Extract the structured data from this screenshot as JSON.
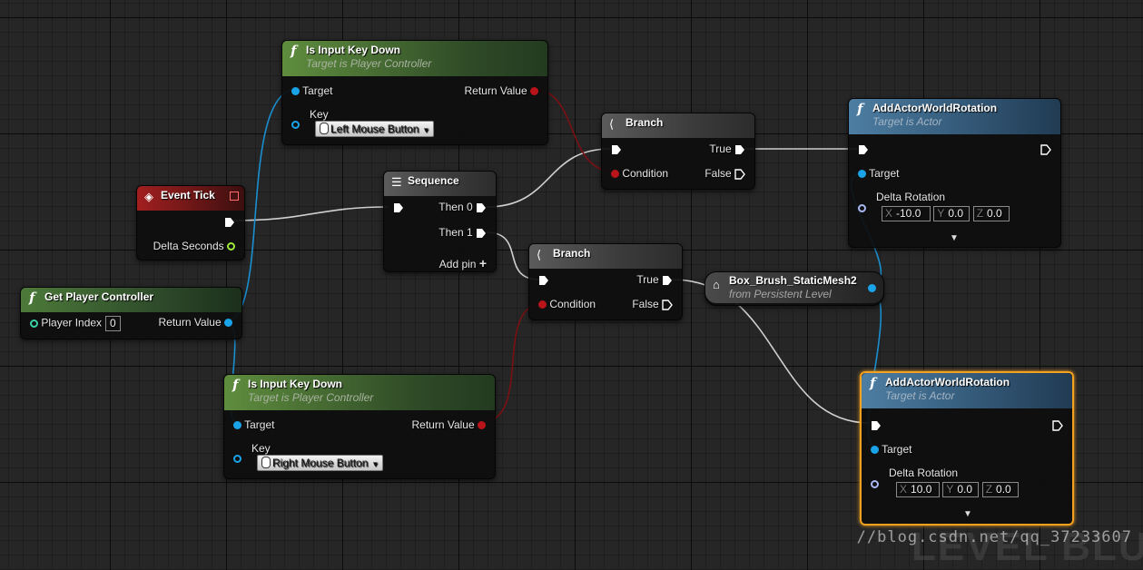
{
  "nodes": {
    "is_key_down_left": {
      "title": "Is Input Key Down",
      "subtitle": "Target is Player Controller",
      "target_label": "Target",
      "key_label": "Key",
      "key_value": "Left Mouse Button",
      "return_label": "Return Value"
    },
    "is_key_down_right": {
      "title": "Is Input Key Down",
      "subtitle": "Target is Player Controller",
      "target_label": "Target",
      "key_label": "Key",
      "key_value": "Right Mouse Button",
      "return_label": "Return Value"
    },
    "event_tick": {
      "title": "Event Tick",
      "delta_label": "Delta Seconds"
    },
    "get_player_controller": {
      "title": "Get Player Controller",
      "index_label": "Player Index",
      "index_value": "0",
      "return_label": "Return Value"
    },
    "sequence": {
      "title": "Sequence",
      "then0": "Then 0",
      "then1": "Then 1",
      "add_pin": "Add pin"
    },
    "branch_top": {
      "title": "Branch",
      "condition": "Condition",
      "true_label": "True",
      "false_label": "False"
    },
    "branch_bottom": {
      "title": "Branch",
      "condition": "Condition",
      "true_label": "True",
      "false_label": "False"
    },
    "box_brush": {
      "title": "Box_Brush_StaticMesh2",
      "subtitle": "from Persistent Level"
    },
    "add_rot_top": {
      "title": "AddActorWorldRotation",
      "subtitle": "Target is Actor",
      "target_label": "Target",
      "delta_label": "Delta Rotation",
      "x_axis": "X",
      "x": "-10.0",
      "y_axis": "Y",
      "y": "0.0",
      "z_axis": "Z",
      "z": "0.0"
    },
    "add_rot_bottom": {
      "title": "AddActorWorldRotation",
      "subtitle": "Target is Actor",
      "target_label": "Target",
      "delta_label": "Delta Rotation",
      "x_axis": "X",
      "x": "10.0",
      "y_axis": "Y",
      "y": "0.0",
      "z_axis": "Z",
      "z": "0.0"
    }
  },
  "watermark": "//blog.csdn.net/qq_37233607",
  "background_text": "LEVEL BLU",
  "colors": {
    "exec": "#ffffff",
    "object_pin": "#1aa3e8",
    "bool_pin": "#b8141a",
    "selected_outline": "#f3a11e",
    "background": "#262626"
  },
  "icons": {
    "function": "function-icon",
    "event": "event-icon",
    "sequence": "sequence-icon",
    "branch": "branch-icon",
    "actor_ref": "actor-reference-icon"
  }
}
